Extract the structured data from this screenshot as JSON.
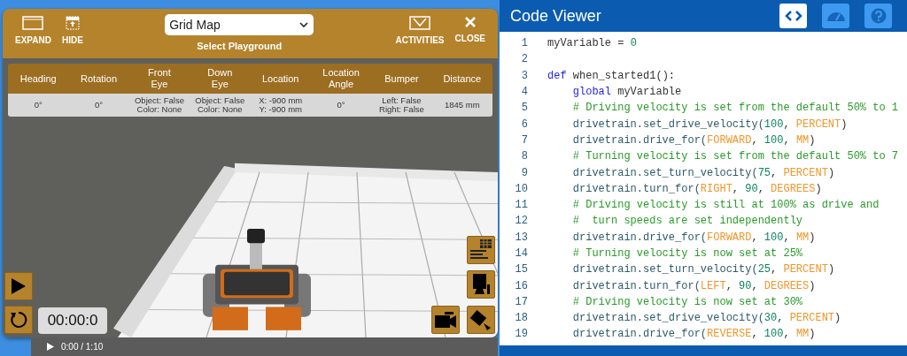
{
  "simulator": {
    "header_left": [
      {
        "kind": "expand",
        "label": "EXPAND"
      },
      {
        "kind": "hide",
        "label": "HIDE"
      }
    ],
    "playground": {
      "value": "Grid Map",
      "label": "Select Playground"
    },
    "header_right": [
      {
        "kind": "activities",
        "label": "ACTIVITIES"
      },
      {
        "kind": "close",
        "label": "CLOSE"
      }
    ],
    "sensor_table": {
      "columns": [
        "Heading",
        "Rotation",
        "Front\nEye",
        "Down\nEye",
        "Location",
        "Location\nAngle",
        "Bumper",
        "Distance"
      ],
      "row": [
        "0°",
        "0°",
        "Object: False\nColor: None",
        "Object: False\nColor: None",
        "X: -900 mm\nY: -900 mm",
        "0°",
        "Left: False\nRight: False",
        "1845 mm"
      ]
    },
    "timer": "00:00:0"
  },
  "code_viewer": {
    "title": "Code Viewer",
    "tools": [
      {
        "kind": "code",
        "selected": true
      },
      {
        "kind": "dashboard",
        "selected": false
      },
      {
        "kind": "help",
        "selected": false
      }
    ],
    "lines": [
      {
        "number": "1",
        "tokens": [
          {
            "kind": "plain",
            "text": "myVariable = "
          },
          {
            "kind": "number",
            "text": "0"
          }
        ]
      },
      {
        "number": "2"
      },
      {
        "number": "3",
        "tokens": [
          {
            "kind": "keyword",
            "text": "def "
          },
          {
            "kind": "plain",
            "text": "when_started1():"
          }
        ]
      },
      {
        "number": "4",
        "tokens": [
          {
            "kind": "keyword",
            "text": "    global "
          },
          {
            "kind": "plain",
            "text": "myVariable"
          }
        ]
      },
      {
        "number": "5",
        "tokens": [
          {
            "kind": "comment",
            "text": "    # Driving velocity is set from the default 50% to 1"
          }
        ]
      },
      {
        "number": "6",
        "tokens": [
          {
            "kind": "obj",
            "text": "    drivetrain.set_drive_velocity("
          },
          {
            "kind": "number",
            "text": "100"
          },
          {
            "kind": "plain",
            "text": ", "
          },
          {
            "kind": "const",
            "text": "PERCENT"
          },
          {
            "kind": "plain",
            "text": ")"
          }
        ]
      },
      {
        "number": "7",
        "tokens": [
          {
            "kind": "obj",
            "text": "    drivetrain.drive_for("
          },
          {
            "kind": "const",
            "text": "FORWARD"
          },
          {
            "kind": "plain",
            "text": ", "
          },
          {
            "kind": "number",
            "text": "100"
          },
          {
            "kind": "plain",
            "text": ", "
          },
          {
            "kind": "const",
            "text": "MM"
          },
          {
            "kind": "plain",
            "text": ")"
          }
        ]
      },
      {
        "number": "8",
        "tokens": [
          {
            "kind": "comment",
            "text": "    # Turning velocity is set from the default 50% to 7"
          }
        ]
      },
      {
        "number": "9",
        "tokens": [
          {
            "kind": "obj",
            "text": "    drivetrain.set_turn_velocity("
          },
          {
            "kind": "number",
            "text": "75"
          },
          {
            "kind": "plain",
            "text": ", "
          },
          {
            "kind": "const",
            "text": "PERCENT"
          },
          {
            "kind": "plain",
            "text": ")"
          }
        ]
      },
      {
        "number": "10",
        "tokens": [
          {
            "kind": "obj",
            "text": "    drivetrain.turn_for("
          },
          {
            "kind": "const",
            "text": "RIGHT"
          },
          {
            "kind": "plain",
            "text": ", "
          },
          {
            "kind": "number",
            "text": "90"
          },
          {
            "kind": "plain",
            "text": ", "
          },
          {
            "kind": "const",
            "text": "DEGREES"
          },
          {
            "kind": "plain",
            "text": ")"
          }
        ]
      },
      {
        "number": "11",
        "tokens": [
          {
            "kind": "comment",
            "text": "    # Driving velocity is still at 100% as drive and"
          }
        ]
      },
      {
        "number": "12",
        "tokens": [
          {
            "kind": "comment",
            "text": "    #  turn speeds are set independently"
          }
        ]
      },
      {
        "number": "13",
        "tokens": [
          {
            "kind": "obj",
            "text": "    drivetrain.drive_for("
          },
          {
            "kind": "const",
            "text": "FORWARD"
          },
          {
            "kind": "plain",
            "text": ", "
          },
          {
            "kind": "number",
            "text": "100"
          },
          {
            "kind": "plain",
            "text": ", "
          },
          {
            "kind": "const",
            "text": "MM"
          },
          {
            "kind": "plain",
            "text": ")"
          }
        ]
      },
      {
        "number": "14",
        "tokens": [
          {
            "kind": "comment",
            "text": "    # Turning velocity is now set at 25%"
          }
        ]
      },
      {
        "number": "15",
        "tokens": [
          {
            "kind": "obj",
            "text": "    drivetrain.set_turn_velocity("
          },
          {
            "kind": "number",
            "text": "25"
          },
          {
            "kind": "plain",
            "text": ", "
          },
          {
            "kind": "const",
            "text": "PERCENT"
          },
          {
            "kind": "plain",
            "text": ")"
          }
        ]
      },
      {
        "number": "16",
        "tokens": [
          {
            "kind": "obj",
            "text": "    drivetrain.turn_for("
          },
          {
            "kind": "const",
            "text": "LEFT"
          },
          {
            "kind": "plain",
            "text": ", "
          },
          {
            "kind": "number",
            "text": "90"
          },
          {
            "kind": "plain",
            "text": ", "
          },
          {
            "kind": "const",
            "text": "DEGREES"
          },
          {
            "kind": "plain",
            "text": ")"
          }
        ]
      },
      {
        "number": "17",
        "tokens": [
          {
            "kind": "comment",
            "text": "    # Driving velocity is now set at 30%"
          }
        ]
      },
      {
        "number": "18",
        "tokens": [
          {
            "kind": "obj",
            "text": "    drivetrain.set_drive_velocity("
          },
          {
            "kind": "number",
            "text": "30"
          },
          {
            "kind": "plain",
            "text": ", "
          },
          {
            "kind": "const",
            "text": "PERCENT"
          },
          {
            "kind": "plain",
            "text": ")"
          }
        ]
      },
      {
        "number": "19",
        "tokens": [
          {
            "kind": "obj",
            "text": "    drivetrain.drive_for("
          },
          {
            "kind": "const",
            "text": "REVERSE"
          },
          {
            "kind": "plain",
            "text": ", "
          },
          {
            "kind": "number",
            "text": "100"
          },
          {
            "kind": "plain",
            "text": ", "
          },
          {
            "kind": "const",
            "text": "MM"
          },
          {
            "kind": "plain",
            "text": ")"
          }
        ]
      }
    ]
  },
  "video_bar": {
    "time": "0:00 / 1:10"
  }
}
